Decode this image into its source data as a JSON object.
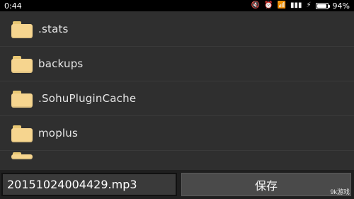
{
  "status_bar": {
    "time": "0:44",
    "battery_percent": "94%",
    "battery_level": 0.94,
    "icons": [
      "mute-icon",
      "alarm-icon",
      "wifi-icon",
      "signal-icon",
      "charging-icon",
      "battery-icon"
    ]
  },
  "file_list": {
    "items": [
      {
        "name": ".stats",
        "icon": "folder-icon"
      },
      {
        "name": "backups",
        "icon": "folder-icon"
      },
      {
        "name": ".SohuPluginCache",
        "icon": "folder-icon"
      },
      {
        "name": "moplus",
        "icon": "folder-icon"
      }
    ]
  },
  "bottom_bar": {
    "filename_value": "20151024004429.mp3",
    "save_label": "保存"
  },
  "watermark": {
    "text": "9k游戏"
  }
}
